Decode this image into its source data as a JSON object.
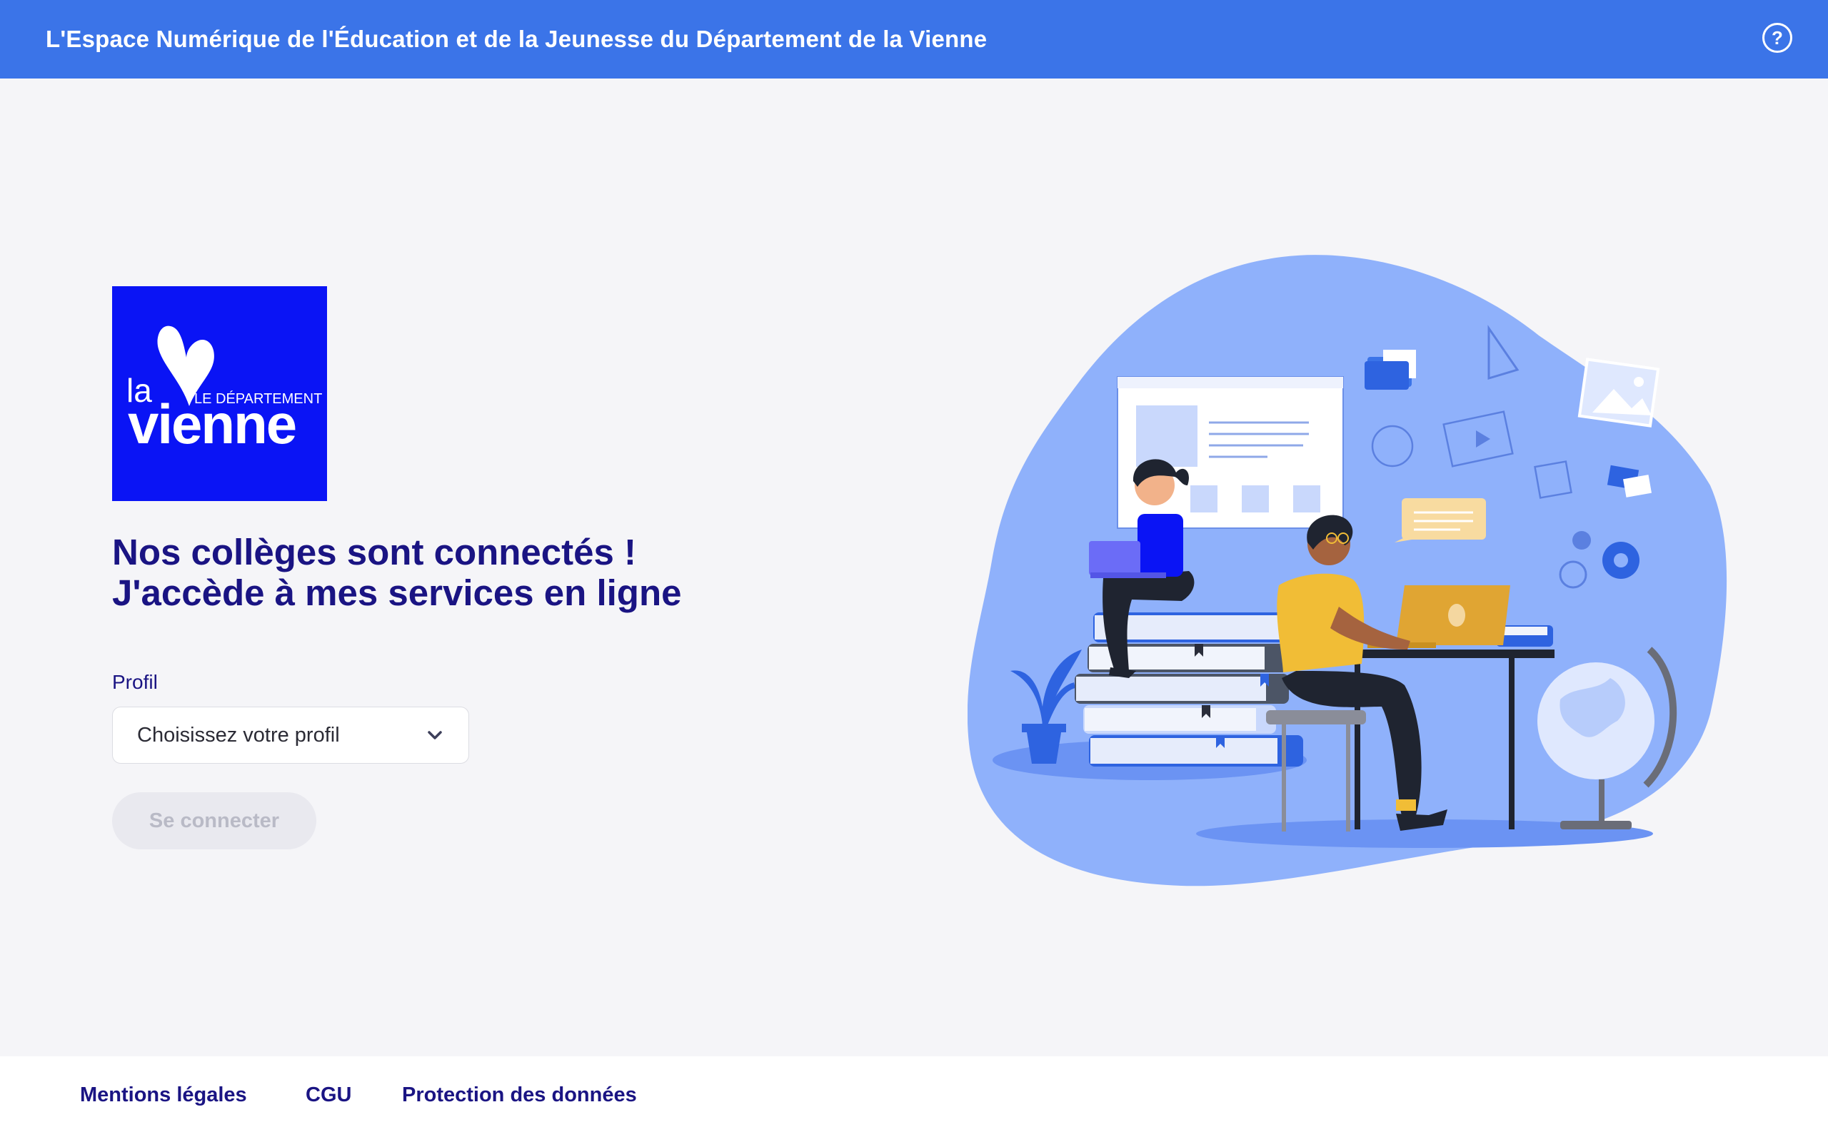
{
  "header": {
    "title": "L'Espace Numérique de l'Éducation et de la Jeunesse du Département de la Vienne",
    "help_icon": "question-circle-icon"
  },
  "logo": {
    "alt": "la Vienne - Le Département",
    "text_la": "la",
    "text_dept": "LE DÉPARTEMENT",
    "text_vienne": "vienne",
    "color": "#0a14f5"
  },
  "main": {
    "headline_line1": "Nos collèges sont connectés !",
    "headline_line2": "J'accède à mes services en ligne",
    "profil_label": "Profil",
    "select_placeholder": "Choisissez votre profil",
    "connect_button": "Se connecter"
  },
  "footer": {
    "links": [
      "Mentions légales",
      "CGU",
      "Protection des données"
    ]
  },
  "colors": {
    "header_bg": "#3b74e8",
    "headline": "#1a1483",
    "blob": "#8fb1fb"
  }
}
